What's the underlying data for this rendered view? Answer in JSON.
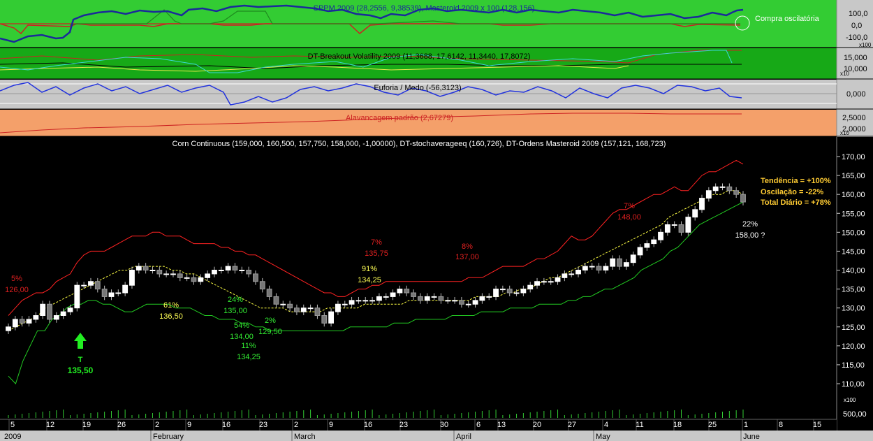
{
  "panels": {
    "sppm": {
      "title": "SPPM 2009 (28,2556, 9,38539), Masteroid 2009 x 100 (128,156)",
      "ticks": [
        "100,0",
        "0,0",
        "-100,0"
      ],
      "note": "Compra oscilatória",
      "colors": {
        "bg": "#33cc33",
        "line1": "#1a2a9a",
        "line2": "#cc2222",
        "line3": "#1f8a1f"
      }
    },
    "breakout": {
      "title": "DT-Breakout Volatility 2009 (11,3688, 17,6142, 11,3440, 17,8072)",
      "ticks": [
        "15,000",
        "10,000"
      ],
      "scale_label": "x10",
      "colors": {
        "bg": "#17a917"
      }
    },
    "euforia": {
      "title": "Euforia / Medo (-56,3123)",
      "ticks": [
        "0,000"
      ],
      "colors": {
        "bg": "#c8c8c8",
        "line": "#2233dd"
      }
    },
    "alavancagem": {
      "title": "Alavancagem padrão (2,67279)",
      "ticks": [
        "2,5000",
        "2,0000"
      ],
      "scale_label": "x10",
      "colors": {
        "bg": "#f4a06a",
        "line": "#cc2222"
      }
    },
    "scale_labels": [
      "x100",
      "x10"
    ]
  },
  "main": {
    "title": "Corn Continuous (159,000, 160,500, 157,750, 158,000, -1,00000), DT-stochaverageeq (160,726), DT-Ordens Masteroid 2009 (157,121, 168,723)",
    "y_ticks": [
      "170,00",
      "165,00",
      "160,00",
      "155,00",
      "150,00",
      "145,00",
      "140,00",
      "135,00",
      "130,00",
      "125,00",
      "120,00",
      "115,00",
      "110,00"
    ],
    "volume_ticks": [
      "x100",
      "500,00"
    ],
    "info": [
      {
        "label": "Tendência = +100%"
      },
      {
        "label": "Oscilação = -22%"
      },
      {
        "label": "Total Diário = +78%"
      }
    ],
    "annotations_red": [
      {
        "pct": "5%",
        "val": "126,00"
      },
      {
        "pct": "7%",
        "val": "135,75"
      },
      {
        "pct": "8%",
        "val": "137,00"
      },
      {
        "pct": "7%",
        "val": "148,00"
      }
    ],
    "annotations_yellow": [
      {
        "pct": "61%",
        "val": "136,50"
      },
      {
        "pct": "91%",
        "val": "134,25"
      }
    ],
    "annotations_green": [
      {
        "pct": "24%",
        "val": "135,00"
      },
      {
        "pct": "54%",
        "val": "134,00"
      },
      {
        "pct": "11%",
        "val": "134,25"
      },
      {
        "pct": "2%",
        "val": "129,50"
      }
    ],
    "annotation_white": {
      "pct": "22%",
      "val": "158,00 ?"
    },
    "signal": {
      "letter": "T",
      "val": "135,50"
    }
  },
  "x_axis": {
    "days": [
      "5",
      "12",
      "19",
      "26",
      "2",
      "9",
      "16",
      "23",
      "2",
      "9",
      "16",
      "23",
      "30",
      "6",
      "13",
      "20",
      "27",
      "4",
      "11",
      "18",
      "25",
      "1",
      "8",
      "15"
    ],
    "months": [
      "2009",
      "February",
      "March",
      "April",
      "May",
      "June"
    ]
  },
  "chart_data": {
    "type": "candlestick",
    "title": "Corn Continuous (159,000, 160,500, 157,750, 158,000, -1,00000), DT-stochaverageeq (160,726), DT-Ordens Masteroid 2009 (157,121, 168,723)",
    "x_start": "2009-01-02",
    "x_end": "2009-06-15",
    "ylim": [
      106,
      172
    ],
    "close": [
      125,
      127,
      126,
      127,
      128,
      131,
      127,
      128,
      129,
      130,
      136,
      136,
      137,
      135,
      133,
      134,
      134,
      136,
      140,
      141,
      140,
      140,
      139,
      139,
      139,
      138,
      138,
      137,
      138,
      139,
      140,
      140,
      141,
      140,
      140,
      139,
      137,
      135,
      133,
      131,
      131,
      130,
      129,
      130,
      130,
      128,
      126,
      129,
      131,
      131,
      132,
      132,
      132,
      132,
      133,
      133,
      134,
      135,
      134,
      133,
      132,
      133,
      133,
      132,
      132,
      132,
      131,
      131,
      132,
      133,
      133,
      135,
      135,
      134,
      134,
      135,
      136,
      137,
      137,
      137,
      138,
      139,
      139,
      140,
      141,
      141,
      140,
      141,
      143,
      141,
      142,
      144,
      146,
      147,
      148,
      150,
      152,
      152,
      150,
      154,
      156,
      159,
      161,
      162,
      162,
      161,
      160,
      158
    ],
    "upper_band": [
      128,
      130,
      132,
      133,
      134,
      134,
      135,
      137,
      138,
      139,
      142,
      144,
      145,
      145,
      145,
      146,
      147,
      148,
      149,
      149,
      149,
      150,
      150,
      149,
      149,
      149,
      148,
      147,
      147,
      147,
      147,
      146,
      146,
      145,
      145,
      144,
      144,
      143,
      142,
      141,
      140,
      139,
      138,
      137,
      136,
      135,
      134,
      134,
      133,
      133,
      134,
      135,
      135,
      136,
      136,
      137,
      137,
      137,
      137,
      137,
      137,
      137,
      137,
      137,
      137,
      137,
      137,
      138,
      138,
      138,
      139,
      140,
      141,
      141,
      141,
      141,
      142,
      143,
      143,
      144,
      145,
      147,
      149,
      148,
      148,
      149,
      151,
      153,
      155,
      156,
      156,
      157,
      158,
      159,
      160,
      160,
      161,
      162,
      161,
      161,
      163,
      165,
      166,
      166,
      167,
      168,
      169,
      168
    ],
    "lower_band": [
      112,
      110,
      116,
      120,
      124,
      124,
      127,
      128,
      130,
      131,
      131,
      132,
      132,
      131,
      131,
      130,
      129,
      129,
      130,
      131,
      131,
      131,
      131,
      130,
      130,
      130,
      129,
      128,
      128,
      127,
      127,
      127,
      126,
      126,
      125,
      125,
      124,
      124,
      124,
      124,
      124,
      124,
      124,
      124,
      124,
      124,
      124,
      125,
      125,
      125,
      125,
      125,
      125,
      126,
      126,
      126,
      127,
      127,
      127,
      127,
      127,
      128,
      128,
      128,
      128,
      129,
      129,
      129,
      129,
      130,
      130,
      130,
      130,
      131,
      131,
      131,
      131,
      132,
      132,
      133,
      133,
      134,
      135,
      135,
      136,
      137,
      138,
      140,
      141,
      142,
      143,
      145,
      146,
      148,
      150,
      152,
      153,
      154,
      155,
      156,
      157,
      158
    ],
    "signal_line": [
      124,
      125,
      126,
      127,
      128,
      130,
      131,
      132,
      133,
      134,
      135,
      136,
      137,
      138,
      139,
      140,
      140,
      141,
      141,
      141,
      141,
      141,
      140,
      140,
      139,
      139,
      138,
      137,
      136,
      135,
      134,
      133,
      132,
      131,
      130,
      130,
      130,
      130,
      129,
      129,
      129,
      129,
      129,
      130,
      130,
      130,
      130,
      130,
      131,
      131,
      131,
      131,
      131,
      131,
      132,
      132,
      132,
      132,
      132,
      132,
      132,
      132,
      132,
      133,
      133,
      133,
      133,
      134,
      134,
      135,
      135,
      136,
      137,
      138,
      138,
      139,
      140,
      141,
      142,
      143,
      144,
      145,
      146,
      147,
      148,
      149,
      150,
      151,
      152,
      154,
      155,
      156,
      157,
      158,
      159,
      160,
      160,
      161,
      161,
      160
    ]
  }
}
